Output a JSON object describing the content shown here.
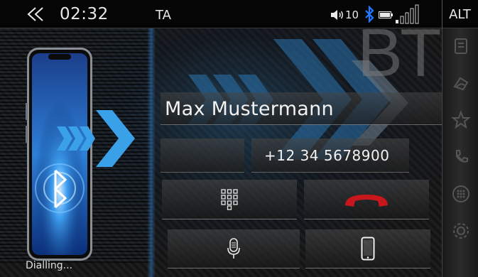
{
  "status_bar": {
    "back_icon": "double-chevron-left-icon",
    "time": "02:32",
    "traffic_announcement": "TA",
    "volume_icon": "speaker-icon",
    "volume_level": "10",
    "bluetooth_icon": "bluetooth-icon",
    "battery_icon": "battery-icon",
    "signal_icon": "signal-bars-icon",
    "alt_label": "ALT"
  },
  "background": {
    "bt_text": "BT"
  },
  "call": {
    "contact_name": "Max Mustermann",
    "phone_number": "+12 34 5678900",
    "status": "Dialling..."
  },
  "buttons": {
    "keypad_icon": "keypad-icon",
    "hangup_icon": "hangup-icon",
    "mic_icon": "microphone-icon",
    "handset_icon": "smartphone-icon"
  },
  "sidebar": {
    "items": [
      {
        "icon": "contacts-book-icon"
      },
      {
        "icon": "recent-calls-icon"
      },
      {
        "icon": "favorites-icon"
      },
      {
        "icon": "voicemail-icon"
      },
      {
        "icon": "dialpad-icon"
      },
      {
        "icon": "settings-icon"
      }
    ]
  },
  "colors": {
    "accent_blue": "#2a8fd6",
    "bluetooth_blue": "#1e7bff",
    "hangup_red": "#c8161d",
    "text": "#f2f2f2"
  }
}
